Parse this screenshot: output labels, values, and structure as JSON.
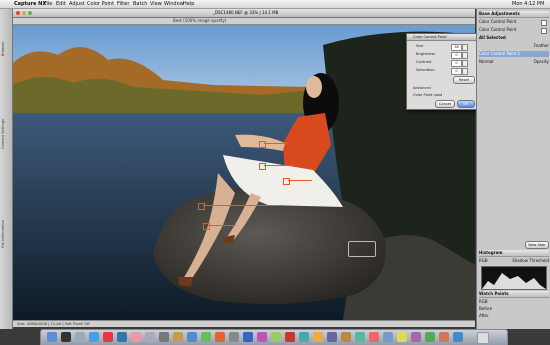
{
  "menubar": {
    "apple": "",
    "items": [
      "Capture NX",
      "File",
      "Edit",
      "Adjust",
      "Color Point",
      "Filter",
      "Batch",
      "View",
      "Window",
      "Help"
    ],
    "clock": "Mon 4:12 PM"
  },
  "window": {
    "title": "_DSC1480.NEF @ 33% | 14.1 MB",
    "subtitle": "Best (100% image quality)",
    "status": "Size: 4288x2848 | 12-bit | Soft Proof: Off"
  },
  "left_tabs": [
    "Browser",
    "Camera Settings",
    "File Information"
  ],
  "dialog": {
    "title": "Color Control Point",
    "sliders": [
      {
        "label": "Size",
        "value": "38"
      },
      {
        "label": "Brightness",
        "value": "0"
      },
      {
        "label": "Contrast",
        "value": "0"
      },
      {
        "label": "Saturation",
        "value": "0"
      }
    ],
    "reset": "Reset",
    "advanced": "Advanced",
    "color_point_label": "Color Point used",
    "cancel": "Cancel",
    "ok": "OK"
  },
  "panel": {
    "header": "Base Adjustments",
    "items": [
      "Color Control Point",
      "Color Control Point",
      "All Selected",
      "Feather",
      "Color Control Point 1",
      "Normal",
      "Opacity"
    ],
    "new_step": "New Step",
    "hist_title": "Histogram",
    "hist_channel": "RGB",
    "hist_thresh": "Shadow Threshold",
    "watch_title": "Watch Points",
    "watch_labels": [
      "RGB",
      "Before",
      "After"
    ]
  },
  "colors": {
    "accent": "#e65a2a",
    "selection": "#8aa6d6"
  },
  "dock": {
    "icons": [
      "finder-icon",
      "dashboard-icon",
      "mail-icon",
      "safari-icon",
      "ical-icon",
      "itunes-icon",
      "iphoto-icon",
      "preview-icon",
      "system-prefs-icon",
      "capture-nx-icon",
      "trash-icon"
    ]
  }
}
